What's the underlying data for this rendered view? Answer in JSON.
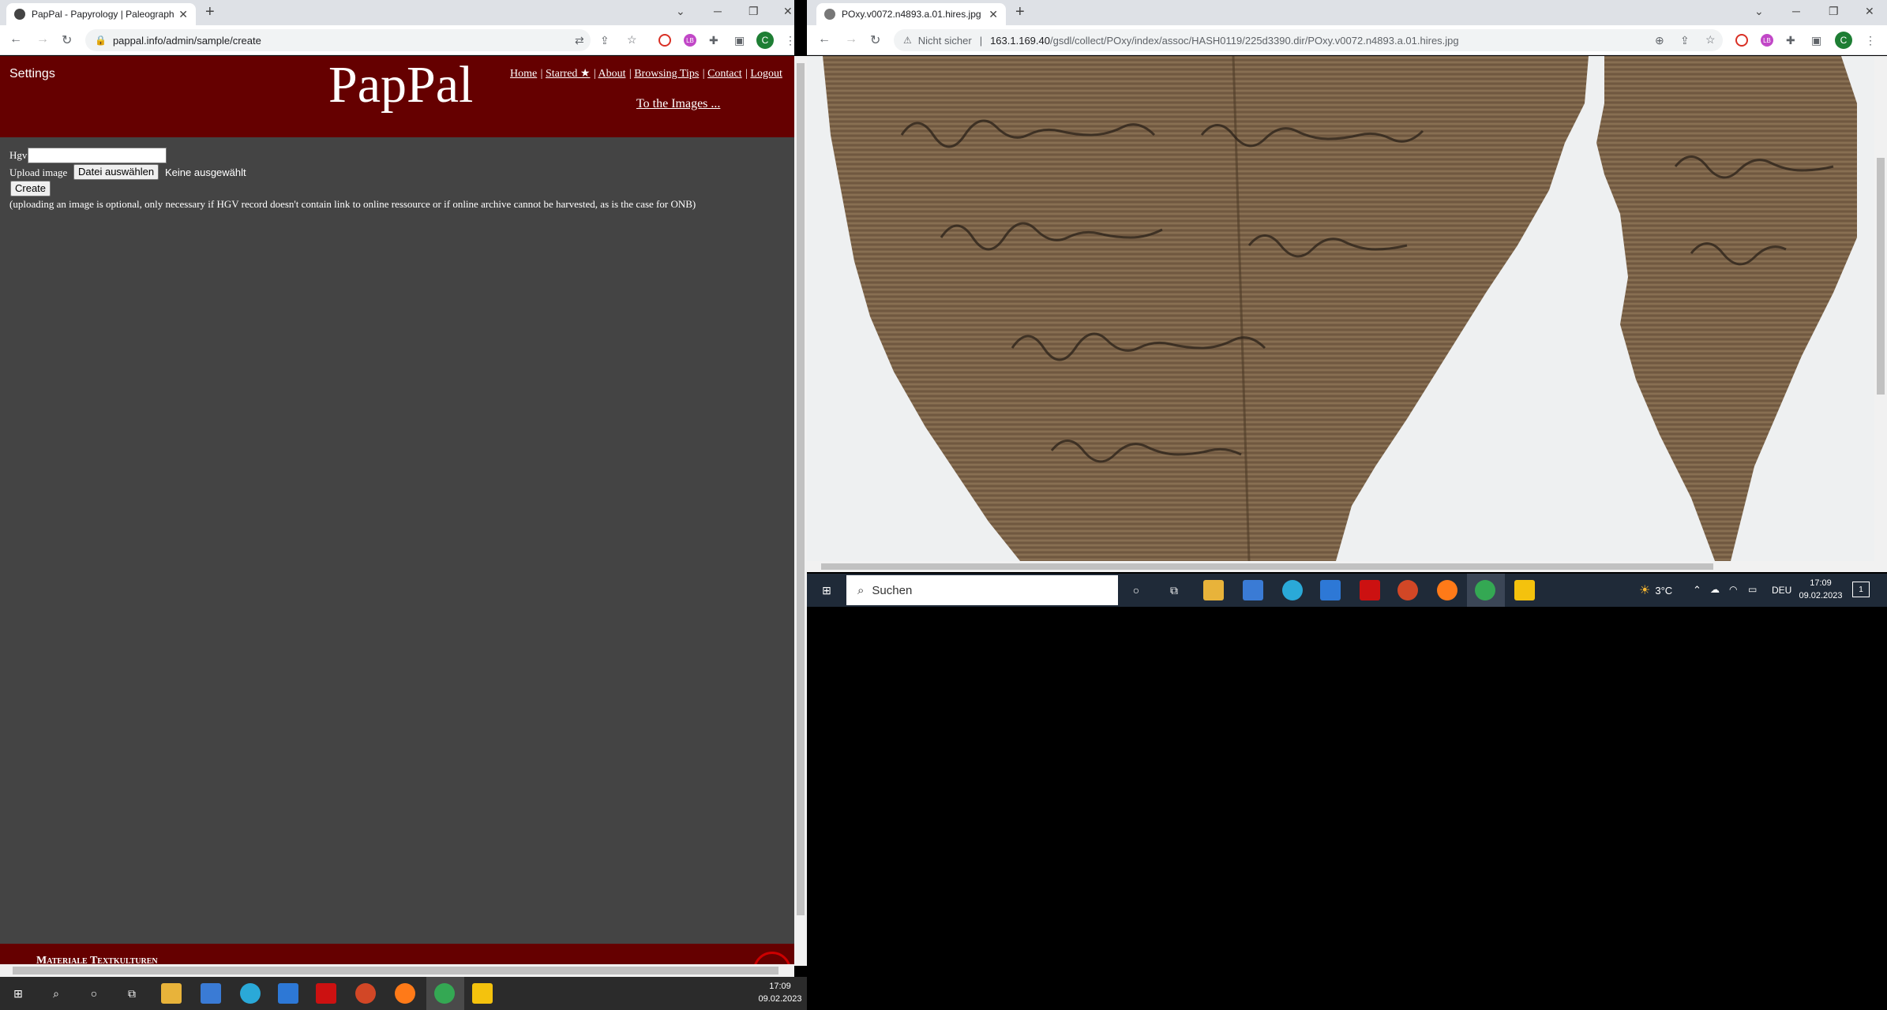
{
  "left_browser": {
    "tab_title": "PapPal - Papyrology | Paleograph",
    "url": "pappal.info/admin/sample/create",
    "profile_initial": "C"
  },
  "right_browser": {
    "tab_title": "POxy.v0072.n4893.a.01.hires.jpg",
    "security_label": "Nicht sicher",
    "url_host": "163.1.169.40",
    "url_path": "/gsdl/collect/POxy/index/assoc/HASH0119/225d3390.dir/POxy.v0072.n4893.a.01.hires.jpg",
    "profile_initial": "C"
  },
  "pappal": {
    "settings": "Settings",
    "logo": "PapPal",
    "nav": [
      "Home",
      "Starred ★",
      "About",
      "Browsing Tips",
      "Contact",
      "Logout"
    ],
    "to_images": "To the Images ...",
    "hgv_label": "Hgv",
    "upload_label": "Upload image",
    "file_button": "Datei auswählen",
    "file_status": "Keine ausgewählt",
    "create_button": "Create",
    "note": "(uploading an image is optional, only necessary if HGV record doesn't contain link to online ressource or if online archive cannot be harvested, as is the case for ONB)",
    "footer_text": "Materiale Textkulturen"
  },
  "taskbar_left": {
    "time": "17:09",
    "date": "09.02.2023"
  },
  "taskbar_right": {
    "search_placeholder": "Suchen",
    "weather": "3°C",
    "language": "DEU",
    "time": "17:09",
    "date": "09.02.2023",
    "notification_count": "1"
  }
}
